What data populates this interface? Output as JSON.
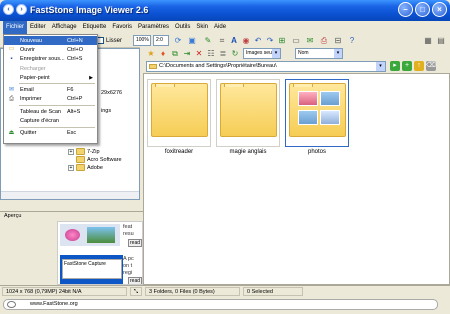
{
  "window": {
    "title": "FastStone Image Viewer 2.6"
  },
  "menubar": {
    "items": [
      "Fichier",
      "Editer",
      "Affichage",
      "Etiquette",
      "Favoris",
      "Paramètres",
      "Outils",
      "Skin",
      "Aide"
    ]
  },
  "file_menu": {
    "items": [
      {
        "label": "Nouveau",
        "shortcut": "Ctrl+N",
        "state": "highlighted"
      },
      {
        "label": "Ouvrir",
        "shortcut": "Ctrl+O",
        "icon": "open-folder-icon"
      },
      {
        "label": "Enregistrer sous...",
        "shortcut": "Ctrl+S",
        "icon": "save-icon"
      },
      {
        "label": "Recharger",
        "shortcut": "",
        "state": "disabled"
      },
      {
        "label": "Papier-peint",
        "shortcut": "",
        "submenu": true
      },
      {
        "separator": true
      },
      {
        "label": "Email",
        "shortcut": "F6",
        "icon": "email-icon"
      },
      {
        "label": "Imprimer",
        "shortcut": "Ctrl+P",
        "icon": "printer-icon"
      },
      {
        "separator": true
      },
      {
        "label": "Tableau de Scan",
        "shortcut": "Alt+S"
      },
      {
        "label": "Capture d'écran",
        "shortcut": ""
      },
      {
        "separator": true
      },
      {
        "label": "Quitter",
        "shortcut": "Esc",
        "icon": "exit-icon"
      }
    ]
  },
  "left_toolbar": {
    "lisser_label": "Lisser",
    "zoom_value": "100%",
    "zoom_fit": "2:0"
  },
  "right_toolbar": {
    "view_select": "Images seules",
    "sort_select": "Nom"
  },
  "tree": {
    "partial_text_1": "29x6276",
    "partial_text_2": "ings",
    "nodes": [
      "7-Zip",
      "Acro Software",
      "Adobe"
    ]
  },
  "address": {
    "path": "C:\\Documents and Settings\\Propriétaire\\Bureau\\"
  },
  "thumbnails": [
    {
      "label": "foxitreader",
      "kind": "folder"
    },
    {
      "label": "magie anglais",
      "kind": "folder"
    },
    {
      "label": "photos",
      "kind": "photo-folder"
    }
  ],
  "apercu": {
    "header": "Aperçu",
    "text_lines": [
      "feat",
      "resu"
    ],
    "read_label": "read",
    "capture_title": "FastStone Capture",
    "capture_lines": [
      "A pc",
      "on t",
      "regi"
    ],
    "read_label_2": "read"
  },
  "status": {
    "image_info": "1024 x 768 (0,79MP)  24bit N/A",
    "folder_info": "3 Folders, 0 Files (0 Bytes)",
    "selected": "0 Selected"
  },
  "footer": {
    "url": "www.FastStone.org"
  },
  "colors": {
    "titlebar": "#0a50d0",
    "highlight": "#316ac5",
    "folder": "#f6cd55"
  }
}
